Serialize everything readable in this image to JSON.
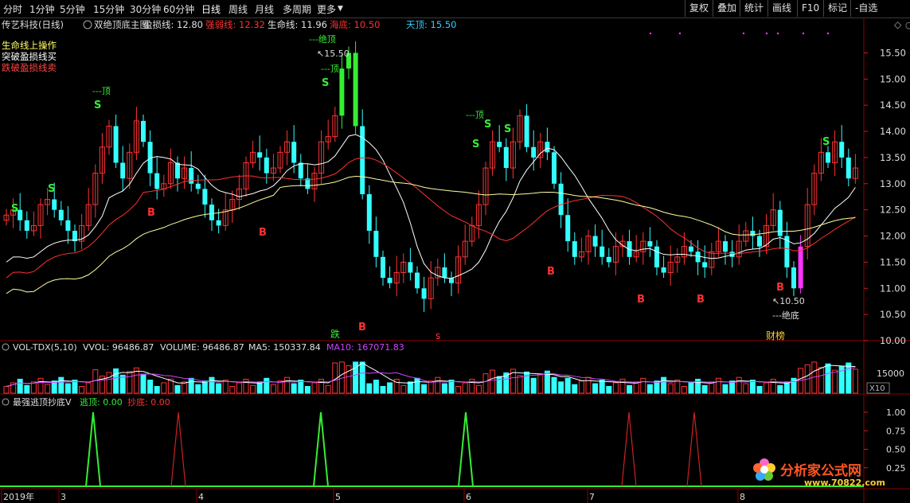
{
  "toolbar": {
    "periods": [
      "分时",
      "1分钟",
      "5分钟",
      "15分钟",
      "30分钟",
      "60分钟",
      "日线",
      "周线",
      "月线",
      "多周期",
      "更多"
    ],
    "active_period": "日线",
    "right_buttons": [
      "复权",
      "叠加",
      "统计",
      "画线",
      "F10",
      "标记",
      "-自选"
    ]
  },
  "main_legend": {
    "stock": "传艺科技(日线)",
    "indicator": "双绝顶底主图",
    "items": [
      {
        "label": "盈损线: 12.80",
        "color": "#e0e0e0"
      },
      {
        "label": "强弱线: 12.32",
        "color": "#ff3030"
      },
      {
        "label": "生命线: 11.96",
        "color": "#e0e0e0"
      },
      {
        "label": "海底: 10.50",
        "color": "#ff3030"
      },
      {
        "label": "天顶: 15.50",
        "color": "#33ccff"
      }
    ],
    "notes": [
      {
        "text": "生命线上操作",
        "color": "#ffff66"
      },
      {
        "text": "突破盈损线买",
        "color": "#ffffff"
      },
      {
        "text": "跌破盈损线卖",
        "color": "#ff4444"
      }
    ]
  },
  "vol_legend": {
    "name": "VOL-TDX(5,10)",
    "items": [
      {
        "label": "VVOL: 96486.87",
        "color": "#e0e0e0"
      },
      {
        "label": "VOLUME: 96486.87",
        "color": "#e0e0e0"
      },
      {
        "label": "MA5: 150337.84",
        "color": "#e0e0e0"
      },
      {
        "label": "MA10: 167071.83",
        "color": "#cc44ff"
      }
    ],
    "scale_tick": "15000",
    "scale_unit": "X10"
  },
  "sub_legend": {
    "name": "最强逃顶抄底V",
    "items": [
      {
        "label": "逃顶: 0.00",
        "color": "#33ee33"
      },
      {
        "label": "抄底: 0.00",
        "color": "#ff3030"
      }
    ],
    "ticks": [
      "1.00",
      "0.75",
      "0.50",
      "0.25"
    ]
  },
  "price_axis": [
    "15.50",
    "15.00",
    "14.50",
    "14.00",
    "13.50",
    "13.00",
    "12.50",
    "12.00",
    "11.50",
    "11.00",
    "10.50",
    "10.00"
  ],
  "date_axis": [
    "2019年",
    "3",
    "4",
    "5",
    "6",
    "7",
    "8"
  ],
  "annotations": {
    "top_label": "---绝顶",
    "top_price": "15.50",
    "ding_label": "---顶",
    "bottom_price": "10.50",
    "bottom_label": "---绝底",
    "die": "跌",
    "cai": "财榜",
    "s": "S",
    "b": "B",
    "small_s": "s"
  },
  "watermark": {
    "text": "分析家公式网",
    "url": "www.70822.com"
  },
  "colors": {
    "up": "#ff3333",
    "down": "#33ffff",
    "life": "#ffffff",
    "strength": "#ff3030",
    "profit": "#ffffa0",
    "ma10": "#cc44ff",
    "green": "#33ee33",
    "magenta": "#ff33ff"
  }
}
